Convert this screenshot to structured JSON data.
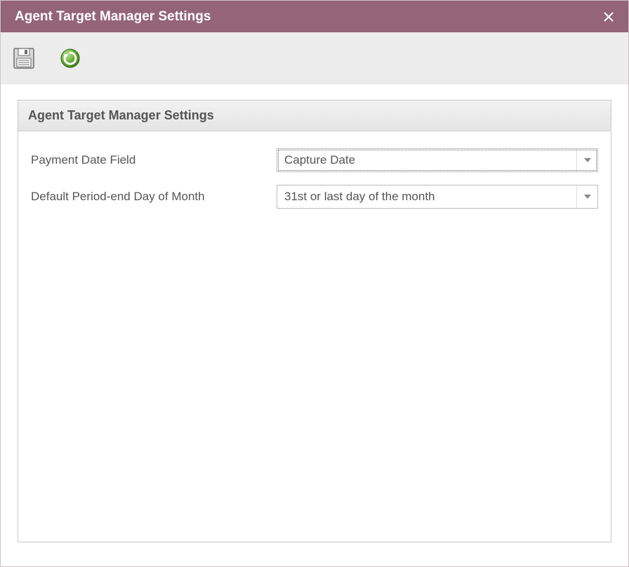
{
  "window": {
    "title": "Agent Target Manager Settings"
  },
  "panel": {
    "heading": "Agent Target Manager Settings"
  },
  "form": {
    "payment_date_field": {
      "label": "Payment Date Field",
      "value": "Capture Date"
    },
    "default_period_end": {
      "label": "Default Period-end Day of Month",
      "value": "31st or last day of the month"
    }
  },
  "icons": {
    "close": "close-icon",
    "save": "diskette-icon",
    "refresh": "refresh-icon"
  },
  "colors": {
    "titlebar_bg": "#946477",
    "toolbar_bg": "#ececec",
    "refresh_green": "#5aa324",
    "refresh_green_dark": "#3d7a17"
  }
}
